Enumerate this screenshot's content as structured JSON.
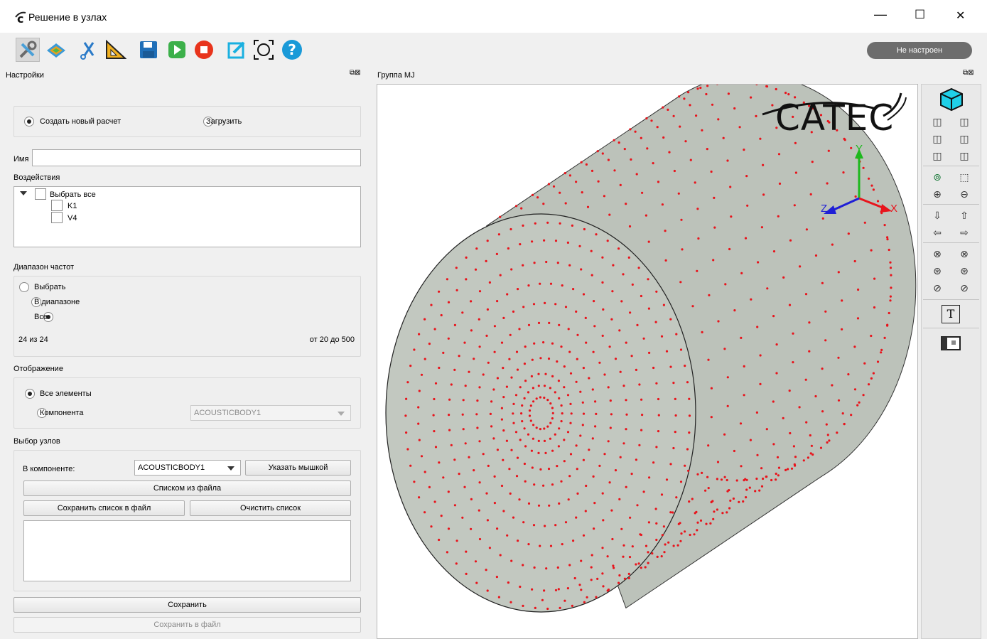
{
  "window": {
    "title": "Решение в узлах",
    "min_glyph": "—",
    "max_glyph": "☐",
    "close_glyph": "✕"
  },
  "toolbar": {
    "status": "Не настроен",
    "icons": [
      "settings-icon",
      "mesh-view-icon",
      "cut-icon",
      "measure-icon",
      "save-icon",
      "run-icon",
      "stop-icon",
      "edit-icon",
      "fit-view-icon",
      "help-icon"
    ]
  },
  "settings_panel": {
    "title": "Настройки",
    "mode": {
      "new_calc": "Создать новый расчет",
      "load": "Загрузить",
      "selected": "new"
    },
    "name_label": "Имя",
    "name_value": "",
    "loads": {
      "label": "Воздействия",
      "select_all": "Выбрать все",
      "items": [
        "K1",
        "V4"
      ]
    },
    "freq": {
      "label": "Диапазон частот",
      "options": [
        "Выбрать",
        "В диапазоне",
        "Все"
      ],
      "selected": "Все",
      "count": "24 из 24",
      "range": "от 20 до 500"
    },
    "display": {
      "label": "Отображение",
      "all": "Все элементы",
      "component": "Компонента",
      "component_value": "ACOUSTICBODY1"
    },
    "nodes": {
      "label": "Выбор узлов",
      "in_component": "В компоненте:",
      "component_value": "ACOUSTICBODY1",
      "pick_mouse": "Указать мышкой",
      "from_file": "Списком из файла",
      "save_list": "Сохранить список в файл",
      "clear_list": "Очистить список"
    },
    "save": "Сохранить",
    "save_to_file": "Сохранить в файл"
  },
  "viewport": {
    "title": "Группа MJ",
    "logo": "CATEC",
    "axes": {
      "x": "X",
      "y": "Y",
      "z": "Z"
    },
    "colors": {
      "body": "#bcc2ba",
      "nodes": "#e8141c",
      "axis_x": "#e8141c",
      "axis_y": "#1db81d",
      "axis_z": "#1f1fd6"
    }
  },
  "view_tools": [
    "cube-view-icon",
    "view-front-icon",
    "view-back-icon",
    "view-left-icon",
    "view-right-icon",
    "view-top-icon",
    "view-bottom-icon",
    "zoom-fit-icon",
    "zoom-box-icon",
    "zoom-in-icon",
    "zoom-out-icon",
    "pan-down-icon",
    "pan-up-icon",
    "pan-left-icon",
    "pan-right-icon",
    "rotate-x-cw-icon",
    "rotate-x-ccw-icon",
    "rotate-y-cw-icon",
    "rotate-y-ccw-icon",
    "rotate-z-cw-icon",
    "rotate-z-ccw-icon",
    "text-icon",
    "screenshot-icon"
  ]
}
